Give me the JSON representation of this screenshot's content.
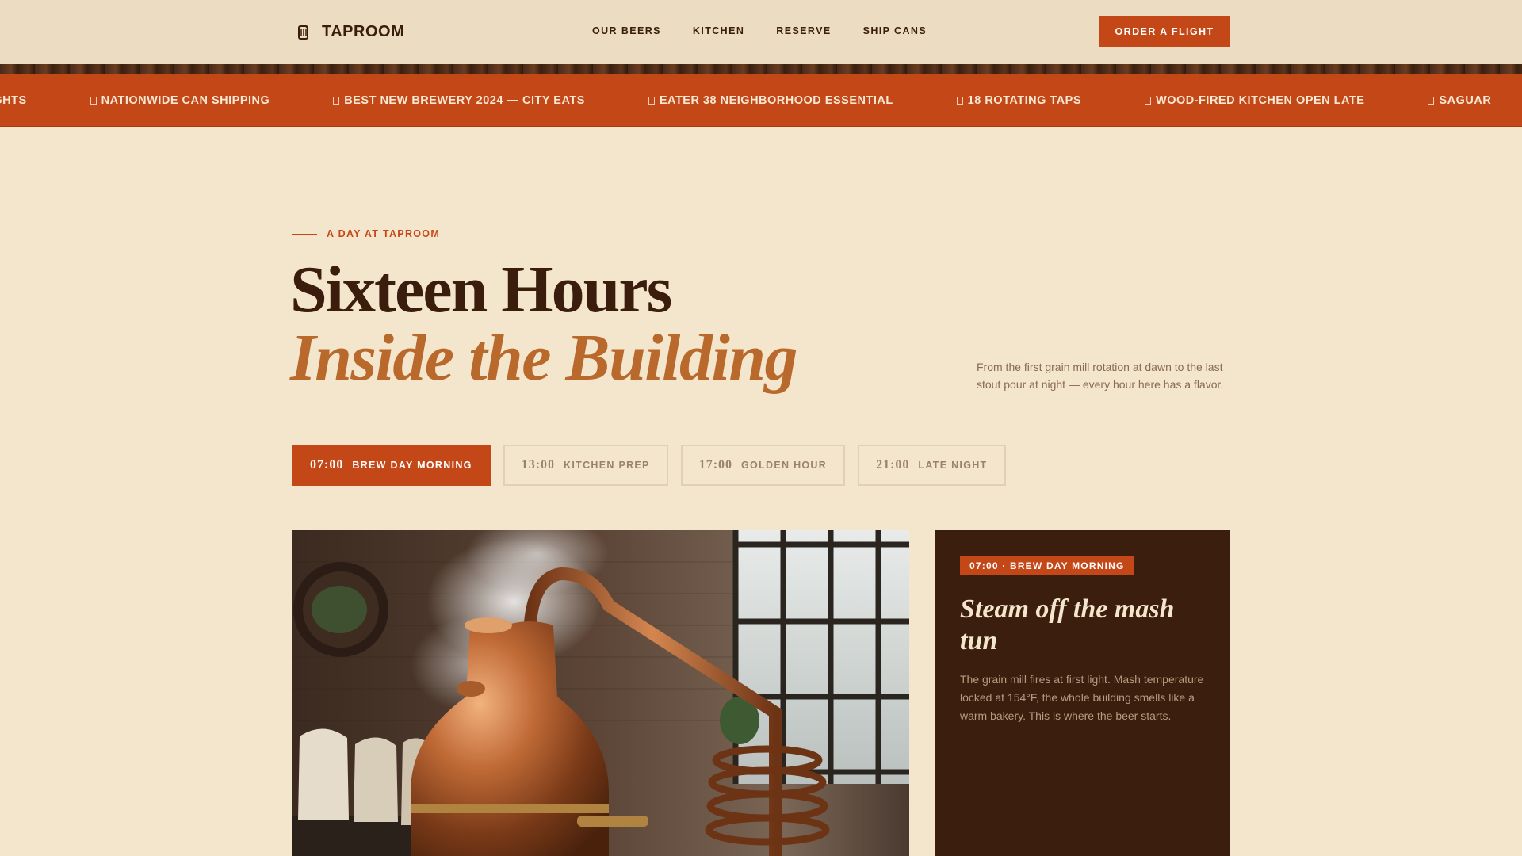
{
  "header": {
    "brand": "TAPROOM",
    "brand_icon": "mug-icon",
    "nav": [
      "OUR BEERS",
      "KITCHEN",
      "RESERVE",
      "SHIP CANS"
    ],
    "cta": "ORDER A FLIGHT"
  },
  "marquee": {
    "items": [
      "HT NIGHTS",
      "NATIONWIDE CAN SHIPPING",
      "BEST NEW BREWERY 2024 — CITY EATS",
      "EATER 38 NEIGHBORHOOD ESSENTIAL",
      "18 ROTATING TAPS",
      "WOOD-FIRED KITCHEN OPEN LATE",
      "SAGUAR"
    ]
  },
  "hero": {
    "eyebrow": "A DAY AT TAPROOM",
    "title_line1": "Sixteen Hours",
    "title_line2": "Inside the Building",
    "lede": "From the first grain mill rotation at dawn to the last stout pour at night — every hour here has a flavor."
  },
  "tabs": [
    {
      "time": "07:00",
      "label": "BREW DAY MORNING",
      "active": true
    },
    {
      "time": "13:00",
      "label": "KITCHEN PREP",
      "active": false
    },
    {
      "time": "17:00",
      "label": "GOLDEN HOUR",
      "active": false
    },
    {
      "time": "21:00",
      "label": "LATE NIGHT",
      "active": false
    }
  ],
  "card": {
    "badge": "07:00 · BREW DAY MORNING",
    "title": "Steam off the mash tun",
    "text": "The grain mill fires at first light. Mash temperature locked at 154°F, the whole building smells like a warm bakery. This is where the beer starts."
  },
  "colors": {
    "accent": "#c34717",
    "background": "#f4e6cc",
    "dark": "#3b1e0d",
    "gold": "#b8692b"
  }
}
